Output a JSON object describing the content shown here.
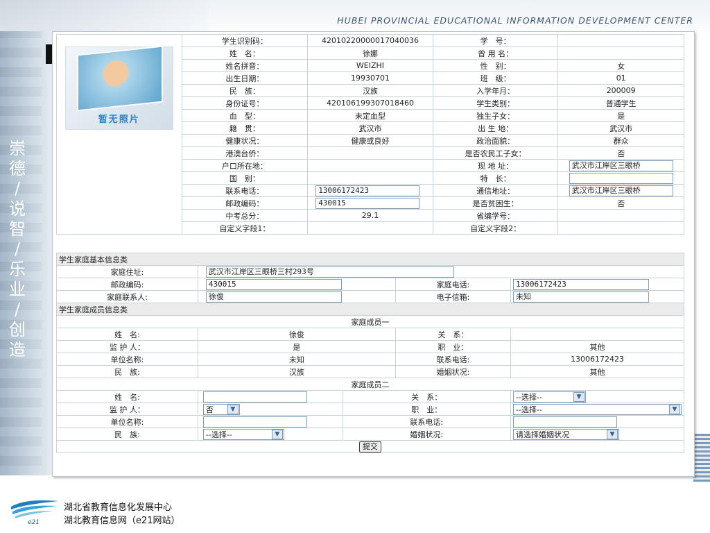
{
  "header": {
    "org_en": "HUBEI PROVINCIAL EDUCATIONAL INFORMATION DEVELOPMENT CENTER"
  },
  "motto": [
    "崇",
    "德",
    "/",
    "说",
    "智",
    "/",
    "乐",
    "业",
    "/",
    "创",
    "造"
  ],
  "photo": {
    "label": "暂无照片"
  },
  "student": {
    "id_label": "学生识别码：",
    "id_value": "42010220000017040036",
    "no_label": "学　号：",
    "no_value": "",
    "name_label": "姓　名：",
    "name_value": "徐娜",
    "former_label": "曾 用 名：",
    "former_value": "",
    "pinyin_label": "姓名拼音：",
    "pinyin_value": "WEIZHI",
    "sex_label": "性　别：",
    "sex_value": "女",
    "birth_label": "出生日期：",
    "birth_value": "19930701",
    "class_label": "班　级：",
    "class_value": "01",
    "nation_label": "民　族：",
    "nation_value": "汉族",
    "enroll_label": "入学年月：",
    "enroll_value": "200009",
    "idcard_label": "身份证号：",
    "idcard_value": "420106199307018460",
    "type_label": "学生类别：",
    "type_value": "普通学生",
    "blood_label": "血　型：",
    "blood_value": "未定血型",
    "only_label": "独生子女：",
    "only_value": "是",
    "native_label": "籍　贯：",
    "native_value": "武汉市",
    "birthplace_label": "出 生 地：",
    "birthplace_value": "武汉市",
    "health_label": "健康状况：",
    "health_value": "健康或良好",
    "political_label": "政治面貌：",
    "political_value": "群众",
    "hkmt_label": "港澳台侨：",
    "hkmt_value": "",
    "farmer_label": "是否农民工子女：",
    "farmer_value": "否",
    "hukou_label": "户口所在地：",
    "hukou_value": "",
    "address_label": "现 地 址：",
    "address_value": "武汉市江岸区三眼桥",
    "country_label": "国　别：",
    "country_value": "",
    "talent_label": "特　长：",
    "talent_value": "",
    "phone_label": "联系电话：",
    "phone_value": "13006172423",
    "mail_addr_label": "通信地址：",
    "mail_addr_value": "武汉市江岸区三眼桥",
    "zip_label": "邮政编码：",
    "zip_value": "430015",
    "poor_label": "是否贫困生：",
    "poor_value": "否",
    "exam_label": "中考总分：",
    "exam_value": "29.1",
    "prov_label": "省编学号：",
    "prov_value": "",
    "custom1_label": "自定义字段1：",
    "custom1_value": "",
    "custom2_label": "自定义字段2：",
    "custom2_value": ""
  },
  "family_basic": {
    "section_title": "学生家庭基本信息类",
    "addr_label": "家庭住址:",
    "addr_value": "武汉市江岸区三眼桥三村293号",
    "zip_label": "邮政编码:",
    "zip_value": "430015",
    "phone_label": "家庭电话:",
    "phone_value": "13006172423",
    "contact_label": "家庭联系人:",
    "contact_value": "徐俊",
    "email_label": "电子信箱:",
    "email_value": "未知"
  },
  "family_members": {
    "section_title": "学生家庭成员信息类",
    "m1": {
      "title": "家庭成员一",
      "name_label": "姓　名:",
      "name_value": "徐俊",
      "rel_label": "关　系：",
      "rel_value": "",
      "guard_label": "监 护 人：",
      "guard_value": "是",
      "job_label": "职　业：",
      "job_value": "其他",
      "unit_label": "单位名称:",
      "unit_value": "未知",
      "phone_label": "联系电话:",
      "phone_value": "13006172423",
      "nation_label": "民　族:",
      "nation_value": "汉族",
      "marital_label": "婚姻状况:",
      "marital_value": "其他"
    },
    "m2": {
      "title": "家庭成员二",
      "name_label": "姓　名:",
      "name_value": "",
      "rel_label": "关　系：",
      "rel_value": "--选择--",
      "guard_label": "监 护 人：",
      "guard_value": "否",
      "job_label": "职　业：",
      "job_value": "--选择--",
      "unit_label": "单位名称:",
      "unit_value": "",
      "phone_label": "联系电话:",
      "phone_value": "",
      "nation_label": "民　族:",
      "nation_value": "--选择--",
      "marital_label": "婚姻状况:",
      "marital_value": "请选择婚姻状况"
    }
  },
  "submit_label": "提交",
  "footer": {
    "org_line1": "湖北省教育信息化发展中心",
    "org_line2": "湖北教育信息网（e21网站）",
    "logo_text": "e21"
  }
}
